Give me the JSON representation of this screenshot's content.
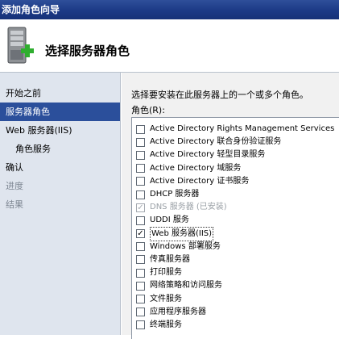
{
  "window": {
    "title": "添加角色向导"
  },
  "header": {
    "title": "选择服务器角色",
    "icon": "server-add-icon"
  },
  "nav": {
    "items": [
      {
        "label": "开始之前",
        "state": "normal"
      },
      {
        "label": "服务器角色",
        "state": "active"
      },
      {
        "label": "Web 服务器(IIS)",
        "state": "normal"
      },
      {
        "label": "角色服务",
        "state": "sub"
      },
      {
        "label": "确认",
        "state": "normal"
      },
      {
        "label": "进度",
        "state": "disabled"
      },
      {
        "label": "结果",
        "state": "disabled"
      }
    ]
  },
  "main": {
    "instruction": "选择要安装在此服务器上的一个或多个角色。",
    "roles_label": "角色(R):",
    "roles": [
      {
        "label": "Active Directory Rights Management Services",
        "checked": false,
        "disabled": false
      },
      {
        "label": "Active Directory 联合身份验证服务",
        "checked": false,
        "disabled": false
      },
      {
        "label": "Active Directory 轻型目录服务",
        "checked": false,
        "disabled": false
      },
      {
        "label": "Active Directory 域服务",
        "checked": false,
        "disabled": false
      },
      {
        "label": "Active Directory 证书服务",
        "checked": false,
        "disabled": false
      },
      {
        "label": "DHCP 服务器",
        "checked": false,
        "disabled": false
      },
      {
        "label": "DNS 服务器  (已安装)",
        "checked": true,
        "disabled": true
      },
      {
        "label": "UDDI 服务",
        "checked": false,
        "disabled": false
      },
      {
        "label": "Web 服务器(IIS)",
        "checked": true,
        "disabled": false,
        "selected": true
      },
      {
        "label": "Windows 部署服务",
        "checked": false,
        "disabled": false
      },
      {
        "label": "传真服务器",
        "checked": false,
        "disabled": false
      },
      {
        "label": "打印服务",
        "checked": false,
        "disabled": false
      },
      {
        "label": "网络策略和访问服务",
        "checked": false,
        "disabled": false
      },
      {
        "label": "文件服务",
        "checked": false,
        "disabled": false
      },
      {
        "label": "应用程序服务器",
        "checked": false,
        "disabled": false
      },
      {
        "label": "终端服务",
        "checked": false,
        "disabled": false
      }
    ]
  }
}
